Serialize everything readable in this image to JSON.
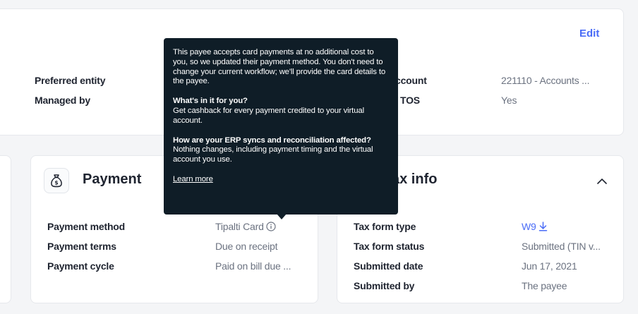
{
  "top_section": {
    "edit_label": "Edit",
    "rows": [
      {
        "label": "Preferred entity"
      },
      {
        "label": "Managed by"
      }
    ],
    "right_rows": [
      {
        "label": "ccount",
        "value": "221110 - Accounts ..."
      },
      {
        "label": "TOS",
        "value": "Yes"
      }
    ]
  },
  "payment": {
    "title": "Payment",
    "icon": "money-bag-icon",
    "rows": [
      {
        "label": "Payment method",
        "value": "Tipalti Card"
      },
      {
        "label": "Payment terms",
        "value": "Due on receipt"
      },
      {
        "label": "Payment cycle",
        "value": "Paid on bill due ..."
      }
    ]
  },
  "tax": {
    "title": "ax info",
    "rows": [
      {
        "label": "Tax form type",
        "value": "W9"
      },
      {
        "label": "Tax form status",
        "value": "Submitted (TIN v..."
      },
      {
        "label": "Submitted date",
        "value": "Jun 17, 2021"
      },
      {
        "label": "Submitted by",
        "value": "The payee"
      }
    ]
  },
  "tooltip": {
    "intro": "This payee accepts card payments at no additional cost to you, so we updated their payment method. You don't need to change your current workflow; we'll provide the card details to the payee.",
    "heading1": "What's in it for you?",
    "body1": "Get cashback for every payment credited to your virtual account.",
    "heading2": "How are your ERP syncs and reconciliation affected?",
    "body2": "Nothing changes, including payment timing and the virtual account you use.",
    "learn_more": "Learn more"
  },
  "colors": {
    "accent": "#4a6cf7",
    "tooltip_bg": "#0f1d27",
    "page_bg": "#f4f5f7"
  }
}
